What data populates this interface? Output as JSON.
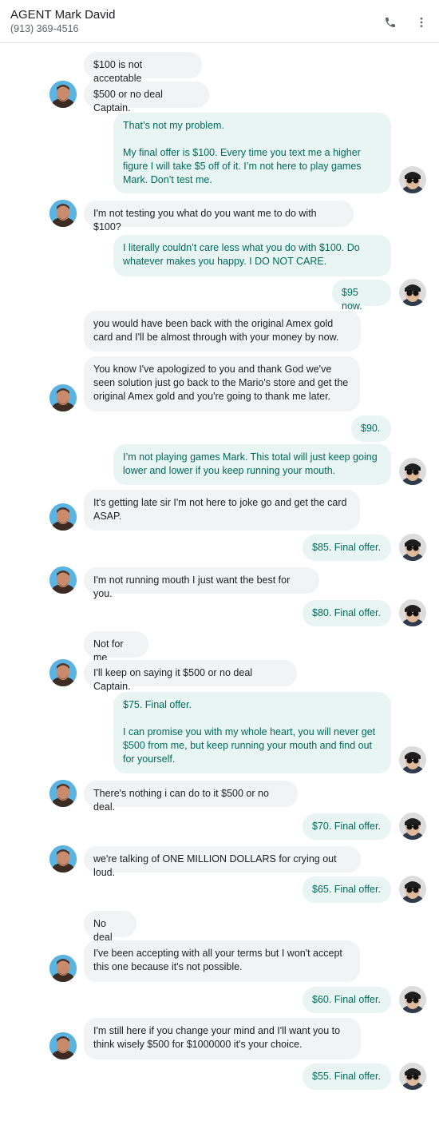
{
  "header": {
    "contact_name": "AGENT Mark David",
    "contact_phone": "(913) 369-4516",
    "call_icon": "phone-icon",
    "menu_icon": "more-vert-icon"
  },
  "messages": [
    {
      "dir": "in",
      "text": "$100 is not acceptable"
    },
    {
      "dir": "in",
      "text": "$500 or no deal Captain."
    },
    {
      "dir": "out",
      "text": "That’s not my problem.\n\nMy final offer is $100. Every time you text me a higher figure I will take $5 off of it. I’m not here to play games Mark. Don’t test me."
    },
    {
      "dir": "in",
      "text": "I'm not testing you what do you want me to do with $100?"
    },
    {
      "dir": "out",
      "text": "I literally couldn’t care less what you do with $100. Do whatever makes you happy. I DO NOT CARE."
    },
    {
      "dir": "out",
      "text": "$95 now."
    },
    {
      "dir": "in",
      "text": "you would have been back with the original Amex gold card and I'll be almost through with your money by now."
    },
    {
      "dir": "in",
      "text": "You know I've apologized to you and thank God we've seen solution just go back to the Mario's store and get the original Amex gold and you're going to thank me later."
    },
    {
      "dir": "out",
      "text": "$90."
    },
    {
      "dir": "out",
      "text": "I’m not playing games Mark. This total will just keep going lower and lower if you keep running your mouth."
    },
    {
      "dir": "in",
      "text": "It's getting late sir I'm not here to joke go and get the card ASAP."
    },
    {
      "dir": "out",
      "text": "$85. Final offer."
    },
    {
      "dir": "in",
      "text": "I'm not running mouth I just want the best for you."
    },
    {
      "dir": "out",
      "text": "$80. Final offer."
    },
    {
      "dir": "in",
      "text": "Not for me"
    },
    {
      "dir": "in",
      "text": "I'll keep on saying it $500 or no deal Captain."
    },
    {
      "dir": "out",
      "text": "$75. Final offer.\n\nI can promise you with my whole heart, you will never get $500 from me, but keep running your mouth and find out for yourself."
    },
    {
      "dir": "in",
      "text": "There's nothing i can do to it $500 or no deal."
    },
    {
      "dir": "out",
      "text": "$70. Final offer."
    },
    {
      "dir": "in",
      "text": "we're talking of ONE MILLION DOLLARS for crying out loud."
    },
    {
      "dir": "out",
      "text": "$65. Final offer."
    },
    {
      "dir": "in",
      "text": "No deal"
    },
    {
      "dir": "in",
      "text": "I've been accepting with all your terms but I won't accept this one because it's not possible."
    },
    {
      "dir": "out",
      "text": "$60. Final offer."
    },
    {
      "dir": "in",
      "text": "I'm still here if you change your mind and I'll want you to think wisely $500 for $1000000 it's your choice."
    },
    {
      "dir": "out",
      "text": "$55. Final offer."
    }
  ]
}
